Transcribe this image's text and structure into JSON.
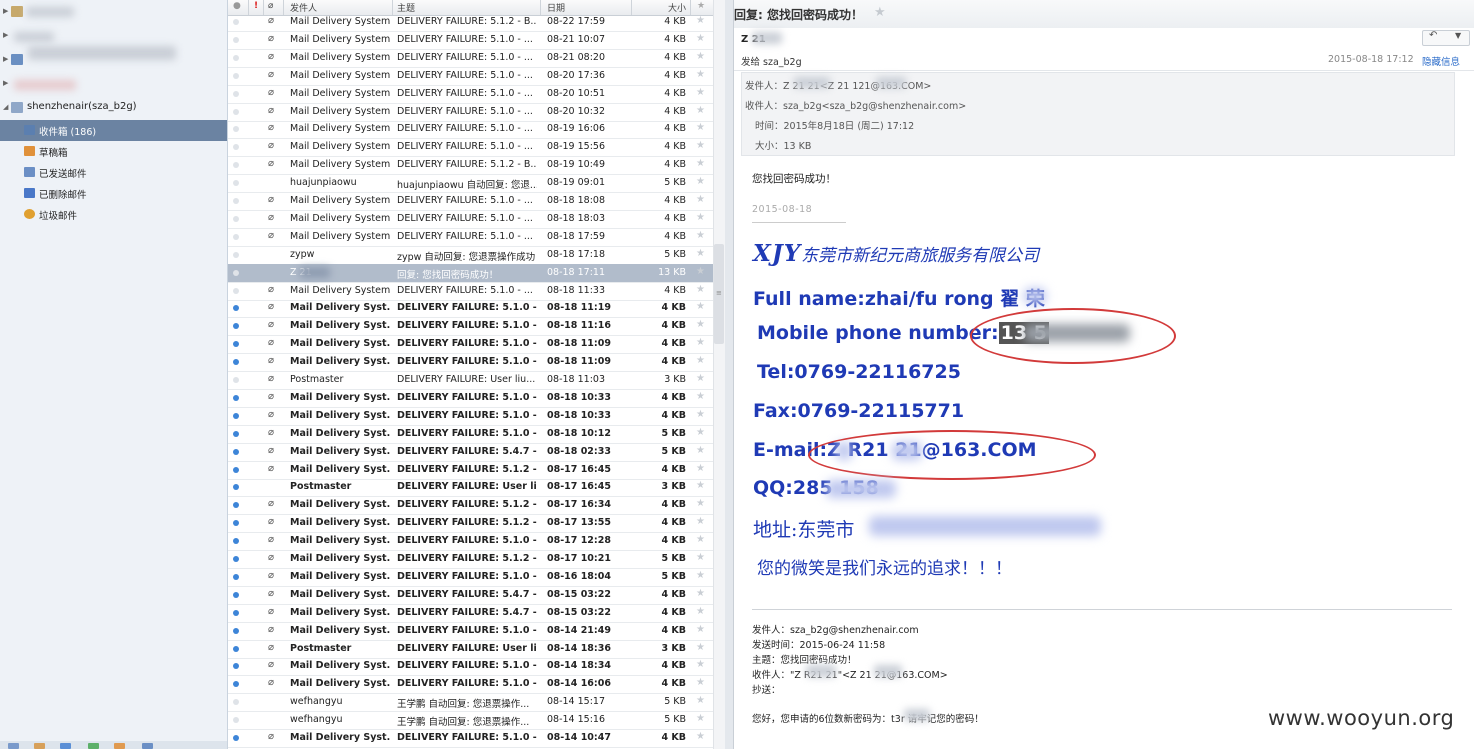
{
  "sidebar": {
    "account": "shenzhenair(sza_b2g)",
    "folders": [
      {
        "label": "收件箱 (186)",
        "icon": "inbox-icon",
        "color": "#5b7fb0"
      },
      {
        "label": "草稿箱",
        "icon": "drafts-icon",
        "color": "#e0913a"
      },
      {
        "label": "已发送邮件",
        "icon": "sent-icon",
        "color": "#6b8fc5"
      },
      {
        "label": "已删除邮件",
        "icon": "trash-icon",
        "color": "#4a78c8"
      },
      {
        "label": "垃圾邮件",
        "icon": "junk-icon",
        "color": "#e0a030"
      }
    ]
  },
  "list": {
    "headers": {
      "flag": "!",
      "sender": "发件人",
      "subject": "主题",
      "date": "日期",
      "size": "大小"
    },
    "rows": [
      {
        "s": "Mail Delivery System",
        "t": "DELIVERY FAILURE: 5.1.2 - B...",
        "d": "08-22 17:59",
        "z": "4 KB",
        "u": false,
        "a": true
      },
      {
        "s": "Mail Delivery System",
        "t": "DELIVERY FAILURE: 5.1.0 - ...",
        "d": "08-21 10:07",
        "z": "4 KB",
        "u": false,
        "a": true
      },
      {
        "s": "Mail Delivery System",
        "t": "DELIVERY FAILURE: 5.1.0 - ...",
        "d": "08-21 08:20",
        "z": "4 KB",
        "u": false,
        "a": true
      },
      {
        "s": "Mail Delivery System",
        "t": "DELIVERY FAILURE: 5.1.0 - ...",
        "d": "08-20 17:36",
        "z": "4 KB",
        "u": false,
        "a": true
      },
      {
        "s": "Mail Delivery System",
        "t": "DELIVERY FAILURE: 5.1.0 - ...",
        "d": "08-20 10:51",
        "z": "4 KB",
        "u": false,
        "a": true
      },
      {
        "s": "Mail Delivery System",
        "t": "DELIVERY FAILURE: 5.1.0 - ...",
        "d": "08-20 10:32",
        "z": "4 KB",
        "u": false,
        "a": true
      },
      {
        "s": "Mail Delivery System",
        "t": "DELIVERY FAILURE: 5.1.0 - ...",
        "d": "08-19 16:06",
        "z": "4 KB",
        "u": false,
        "a": true
      },
      {
        "s": "Mail Delivery System",
        "t": "DELIVERY FAILURE: 5.1.0 - ...",
        "d": "08-19 15:56",
        "z": "4 KB",
        "u": false,
        "a": true
      },
      {
        "s": "Mail Delivery System",
        "t": "DELIVERY FAILURE: 5.1.2 - B...",
        "d": "08-19 10:49",
        "z": "4 KB",
        "u": false,
        "a": true
      },
      {
        "s": "huajunpiaowu",
        "t": "huajunpiaowu 自动回复: 您退...",
        "d": "08-19 09:01",
        "z": "5 KB",
        "u": false,
        "a": false
      },
      {
        "s": "Mail Delivery System",
        "t": "DELIVERY FAILURE: 5.1.0 - ...",
        "d": "08-18 18:08",
        "z": "4 KB",
        "u": false,
        "a": true
      },
      {
        "s": "Mail Delivery System",
        "t": "DELIVERY FAILURE: 5.1.0 - ...",
        "d": "08-18 18:03",
        "z": "4 KB",
        "u": false,
        "a": true
      },
      {
        "s": "Mail Delivery System",
        "t": "DELIVERY FAILURE: 5.1.0 - ...",
        "d": "08-18 17:59",
        "z": "4 KB",
        "u": false,
        "a": true
      },
      {
        "s": "zypw",
        "t": "zypw 自动回复: 您退票操作成功",
        "d": "08-18 17:18",
        "z": "5 KB",
        "u": false,
        "a": false
      },
      {
        "s": "Z 21",
        "t": "回复: 您找回密码成功！",
        "d": "08-18 17:11",
        "z": "13 KB",
        "u": false,
        "a": false,
        "sel": true
      },
      {
        "s": "Mail Delivery System",
        "t": "DELIVERY FAILURE: 5.1.0 - ...",
        "d": "08-18 11:33",
        "z": "4 KB",
        "u": false,
        "a": true
      },
      {
        "s": "Mail Delivery Syst...",
        "t": "DELIVERY FAILURE: 5.1.0 - ...",
        "d": "08-18 11:19",
        "z": "4 KB",
        "u": true,
        "a": true
      },
      {
        "s": "Mail Delivery Syst...",
        "t": "DELIVERY FAILURE: 5.1.0 - ...",
        "d": "08-18 11:16",
        "z": "4 KB",
        "u": true,
        "a": true
      },
      {
        "s": "Mail Delivery Syst...",
        "t": "DELIVERY FAILURE: 5.1.0 - ...",
        "d": "08-18 11:09",
        "z": "4 KB",
        "u": true,
        "a": true
      },
      {
        "s": "Mail Delivery Syst...",
        "t": "DELIVERY FAILURE: 5.1.0 - ...",
        "d": "08-18 11:09",
        "z": "4 KB",
        "u": true,
        "a": true
      },
      {
        "s": "Postmaster",
        "t": "DELIVERY FAILURE: User liu...",
        "d": "08-18 11:03",
        "z": "3 KB",
        "u": false,
        "a": true
      },
      {
        "s": "Mail Delivery Syst...",
        "t": "DELIVERY FAILURE: 5.1.0 - ...",
        "d": "08-18 10:33",
        "z": "4 KB",
        "u": true,
        "a": true
      },
      {
        "s": "Mail Delivery Syst...",
        "t": "DELIVERY FAILURE: 5.1.0 - ...",
        "d": "08-18 10:33",
        "z": "4 KB",
        "u": true,
        "a": true
      },
      {
        "s": "Mail Delivery Syst...",
        "t": "DELIVERY FAILURE: 5.1.0 - ...",
        "d": "08-18 10:12",
        "z": "5 KB",
        "u": true,
        "a": true
      },
      {
        "s": "Mail Delivery Syst...",
        "t": "DELIVERY FAILURE: 5.4.7 - ...",
        "d": "08-18 02:33",
        "z": "5 KB",
        "u": true,
        "a": true
      },
      {
        "s": "Mail Delivery Syst...",
        "t": "DELIVERY FAILURE: 5.1.2 - ...",
        "d": "08-17 16:45",
        "z": "4 KB",
        "u": true,
        "a": true
      },
      {
        "s": "Postmaster",
        "t": "DELIVERY FAILURE: User li...",
        "d": "08-17 16:45",
        "z": "3 KB",
        "u": true,
        "a": false
      },
      {
        "s": "Mail Delivery Syst...",
        "t": "DELIVERY FAILURE: 5.1.2 - ...",
        "d": "08-17 16:34",
        "z": "4 KB",
        "u": true,
        "a": true
      },
      {
        "s": "Mail Delivery Syst...",
        "t": "DELIVERY FAILURE: 5.1.2 - ...",
        "d": "08-17 13:55",
        "z": "4 KB",
        "u": true,
        "a": true
      },
      {
        "s": "Mail Delivery Syst...",
        "t": "DELIVERY FAILURE: 5.1.0 - ...",
        "d": "08-17 12:28",
        "z": "4 KB",
        "u": true,
        "a": true
      },
      {
        "s": "Mail Delivery Syst...",
        "t": "DELIVERY FAILURE: 5.1.2 - ...",
        "d": "08-17 10:21",
        "z": "5 KB",
        "u": true,
        "a": true
      },
      {
        "s": "Mail Delivery Syst...",
        "t": "DELIVERY FAILURE: 5.1.0 - ...",
        "d": "08-16 18:04",
        "z": "5 KB",
        "u": true,
        "a": true
      },
      {
        "s": "Mail Delivery Syst...",
        "t": "DELIVERY FAILURE: 5.4.7 - ...",
        "d": "08-15 03:22",
        "z": "4 KB",
        "u": true,
        "a": true
      },
      {
        "s": "Mail Delivery Syst...",
        "t": "DELIVERY FAILURE: 5.4.7 - ...",
        "d": "08-15 03:22",
        "z": "4 KB",
        "u": true,
        "a": true
      },
      {
        "s": "Mail Delivery Syst...",
        "t": "DELIVERY FAILURE: 5.1.0 - ...",
        "d": "08-14 21:49",
        "z": "4 KB",
        "u": true,
        "a": true
      },
      {
        "s": "Postmaster",
        "t": "DELIVERY FAILURE: User li...",
        "d": "08-14 18:36",
        "z": "3 KB",
        "u": true,
        "a": true
      },
      {
        "s": "Mail Delivery Syst...",
        "t": "DELIVERY FAILURE: 5.1.0 - ...",
        "d": "08-14 18:34",
        "z": "4 KB",
        "u": true,
        "a": true
      },
      {
        "s": "Mail Delivery Syst...",
        "t": "DELIVERY FAILURE: 5.1.0 - ...",
        "d": "08-14 16:06",
        "z": "4 KB",
        "u": true,
        "a": true
      },
      {
        "s": "wefhangyu",
        "t": "王学鹏 自动回复: 您退票操作...",
        "d": "08-14 15:17",
        "z": "5 KB",
        "u": false,
        "a": false
      },
      {
        "s": "wefhangyu",
        "t": "王学鹏 自动回复: 您退票操作...",
        "d": "08-14 15:16",
        "z": "5 KB",
        "u": false,
        "a": false
      },
      {
        "s": "Mail Delivery Syst...",
        "t": "DELIVERY FAILURE: 5.1.0 - ...",
        "d": "08-14 10:47",
        "z": "4 KB",
        "u": true,
        "a": true
      }
    ]
  },
  "reader": {
    "title": "回复: 您找回密码成功！",
    "from_short": "Z 21",
    "to_line": "发给 sza_b2g",
    "date": "2015-08-18 17:12",
    "hide_label": "隐藏信息",
    "info": {
      "from": "发件人：Z 21 21<Z 21 121@163.COM>",
      "to": "收件人：sza_b2g<sza_b2g@shenzhenair.com>",
      "time": "时间：2015年8月18日 (周二) 17:12",
      "size": "大小：13 KB"
    },
    "greeting": "您找回密码成功！",
    "sig_date": "2015-08-18",
    "signature": {
      "logo": "XJY",
      "company": "东莞市新纪元商旅服务有限公司",
      "name": "Full name:zhai/fu rong  翟 荣",
      "mobile_label": "Mobile phone number:",
      "mobile_value": "13 5",
      "tel": "Tel:0769-22116725",
      "fax": "Fax:0769-22115771",
      "email": "E-mail:Z R21 21@163.COM",
      "qq": "QQ:285 158",
      "address": "地址:东莞市",
      "slogan": "您的微笑是我们永远的追求！！！"
    },
    "quote": {
      "from": "发件人：sza_b2g@shenzhenair.com",
      "sent": "发送时间：2015-06-24 11:58",
      "subject": "主题：您找回密码成功！",
      "to": "收件人：\"Z R21 21\"<Z 21 21@163.COM>",
      "cc": "抄送：",
      "body": "您好，您申请的6位数新密码为：t3r 请牢记您的密码！"
    }
  },
  "watermark": "www.wooyun.org",
  "colors": {
    "accent": "#6b83a2",
    "unread_dot": "#3d85d8",
    "signature_blue": "#1f3ab5",
    "annotation_red": "#d23a3a"
  }
}
